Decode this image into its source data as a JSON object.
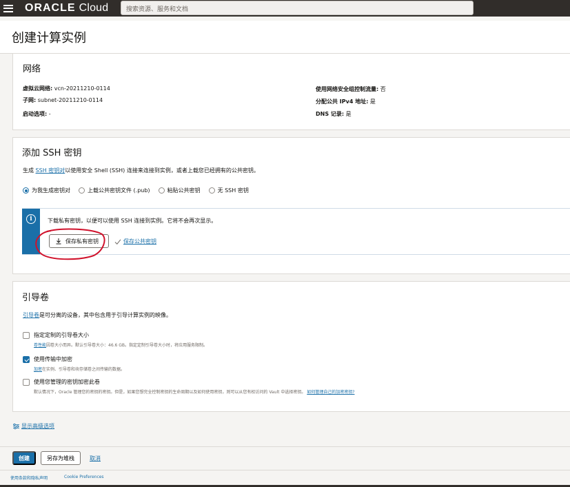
{
  "topbar": {
    "brand_bold": "ORACLE",
    "brand_rest": "Cloud",
    "search_placeholder": "搜索资源、服务和文档"
  },
  "page": {
    "title": "创建计算实例"
  },
  "network": {
    "title": "网络",
    "vcn_label": "虚拟云网络:",
    "vcn_value": " vcn-20211210-0114",
    "subnet_label": "子网:",
    "subnet_value": " subnet-20211210-0114",
    "launch_label": "启动选项:",
    "launch_value": " -",
    "nsg_label": "使用网络安全组控制流量:",
    "nsg_value": " 否",
    "ipv4_label": "分配公共 IPv4 地址:",
    "ipv4_value": " 是",
    "dns_label": "DNS 记录:",
    "dns_value": " 是"
  },
  "ssh": {
    "title": "添加 SSH 密钥",
    "desc_prefix": "生成 ",
    "desc_link": "SSH 密钥对",
    "desc_suffix": "以使用安全 Shell (SSH) 连接来连接到实例，或者上载您已经拥有的公共密钥。",
    "options": [
      {
        "label": "为我生成密钥对",
        "selected": true
      },
      {
        "label": "上载公共密钥文件 (.pub)",
        "selected": false
      },
      {
        "label": "粘贴公共密钥",
        "selected": false
      },
      {
        "label": "无 SSH 密钥",
        "selected": false
      }
    ],
    "info_text": "下载私有密钥，以便可以使用 SSH 连接到实例。它将不会再次显示。",
    "save_private_label": "保存私有密钥",
    "save_public_label": "保存公共密钥"
  },
  "boot": {
    "title": "引导卷",
    "desc_link": "引导卷",
    "desc_suffix": "是可分离的设备，其中包含用于引导计算实例的映像。",
    "options": [
      {
        "title": "指定定制的引导卷大小",
        "sub_link": "卷性能",
        "sub_text": "因卷大小而异。默认引导卷大小：46.6 GB。指定定制引导卷大小时，将应用服务限制。",
        "checked": false
      },
      {
        "title": "使用传输中加密",
        "sub_link": "加密",
        "sub_text": "在实例、引导卷和块存储卷之间传输的数据。",
        "checked": true
      },
      {
        "title": "使用您管理的密钥加密此卷",
        "sub_link": "",
        "sub_text": "默认情况下，Oracle 管理您的密钥的密钥。但是，如果您想完全控制密钥的生命周期以及如何使用密钥，则可以从您有权访问的 Vault 中选择密钥。",
        "sub_link2": "如何管理自己的加密密钥?",
        "checked": false
      }
    ]
  },
  "advanced_label": "显示高级选项",
  "actions": {
    "create": "创建",
    "save_stack": "另存为堆栈",
    "cancel": "取消"
  },
  "footer": {
    "terms": "使用条款和隐私声明",
    "cookies": "Cookie Preferences"
  },
  "colors": {
    "accent": "#1a6fa8",
    "topbar": "#312d2a",
    "annotation": "#d0112b"
  }
}
